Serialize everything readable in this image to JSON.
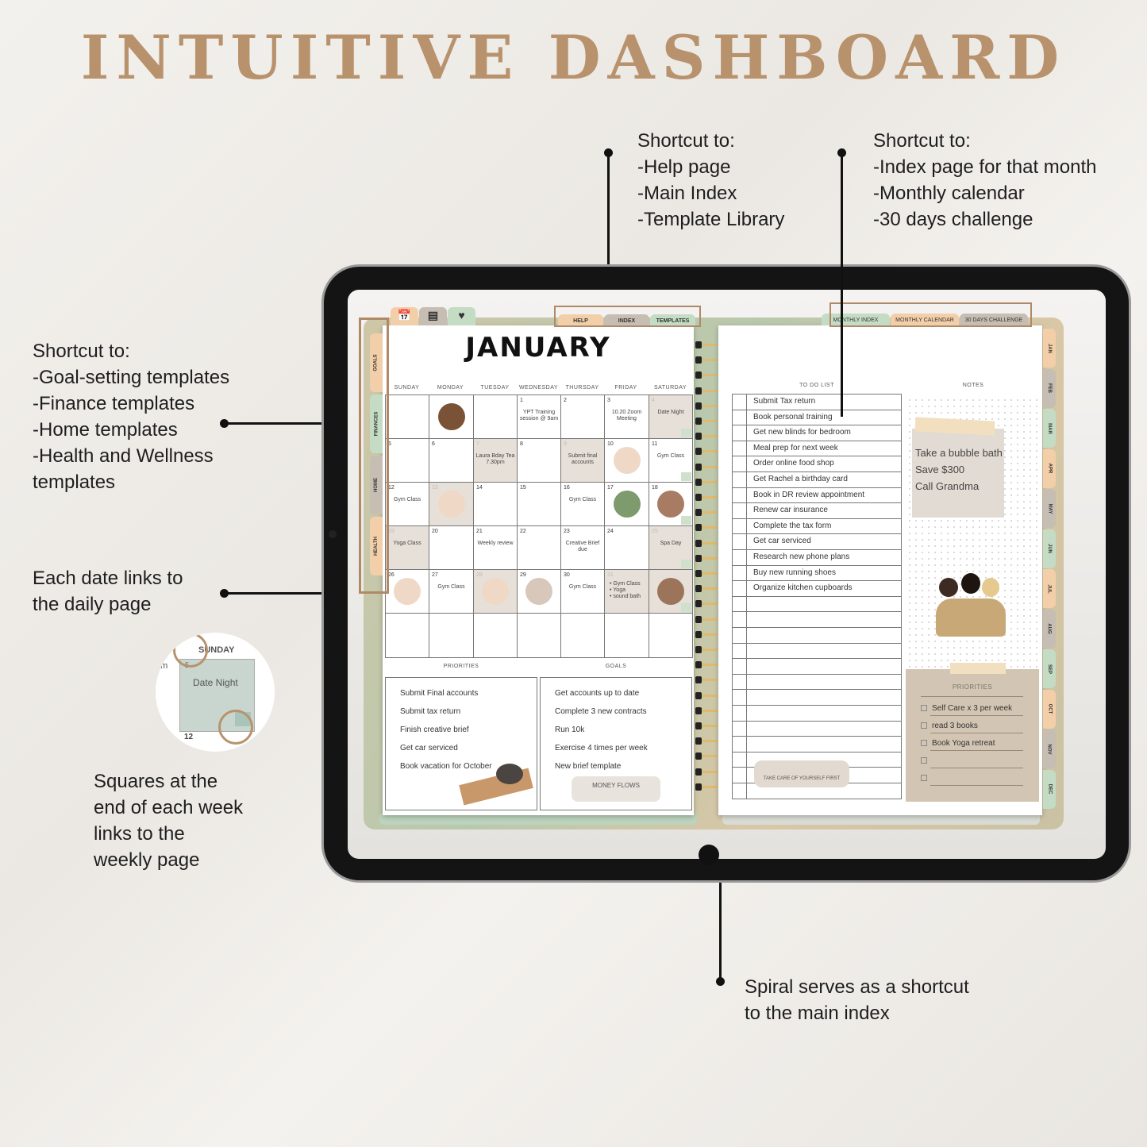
{
  "title": "INTUITIVE DASHBOARD",
  "annotations": {
    "top_middle": "Shortcut to:\n-Help page\n-Main Index\n-Template Library",
    "top_right": "Shortcut to:\n-Index page for that month\n-Monthly calendar\n-30 days challenge",
    "left_categories": "Shortcut to:\n-Goal-setting templates\n-Finance templates\n-Home templates\n-Health and Wellness\ntemplates",
    "left_dates": "Each date links to\nthe daily page",
    "left_weekly": "Squares at the\nend of each week\nlinks to the\nweekly page",
    "bottom_spiral": "Spiral serves as a shortcut\nto the main index"
  },
  "inset": {
    "day_header": "SUNDAY",
    "date": "5",
    "event": "Date Night",
    "next_date": "12",
    "side_text": "om"
  },
  "colors": {
    "accent": "#b8926c",
    "peach": "#f2cfa8",
    "gray": "#c6bdb3",
    "green": "#c4dcc4",
    "shaded": "#e7e0d8",
    "annotation_outline": "#b08a68"
  },
  "left_page": {
    "top_icons": [
      {
        "icon": "calendar-icon"
      },
      {
        "icon": "picture-frame-icon"
      },
      {
        "icon": "heart-icon"
      }
    ],
    "top_tabs": [
      "HELP",
      "INDEX",
      "TEMPLATES"
    ],
    "side_tabs": [
      "GOALS",
      "FINANCES",
      "HOME",
      "HEALTH"
    ],
    "month_title": "JANUARY",
    "weekdays": [
      "SUNDAY",
      "MONDAY",
      "TUESDAY",
      "WEDNESDAY",
      "THURSDAY",
      "FRIDAY",
      "SATURDAY"
    ],
    "cells": [
      {
        "day": "",
        "text": ""
      },
      {
        "day": "",
        "text": "",
        "image": "coffee-beans"
      },
      {
        "day": "",
        "text": ""
      },
      {
        "day": "1",
        "text": "YPT Training session @ 9am"
      },
      {
        "day": "2",
        "text": ""
      },
      {
        "day": "3",
        "text": "10.20 Zoom Meeting"
      },
      {
        "day": "4",
        "text": "Date Night",
        "shaded": true
      },
      {
        "day": "5",
        "text": ""
      },
      {
        "day": "6",
        "text": ""
      },
      {
        "day": "7",
        "text": "Laura Bday Tea 7.30pm",
        "shaded": true
      },
      {
        "day": "8",
        "text": ""
      },
      {
        "day": "9",
        "text": "Submit final accounts",
        "shaded": true
      },
      {
        "day": "10",
        "text": "",
        "image": "flower"
      },
      {
        "day": "11",
        "text": "Gym Class"
      },
      {
        "day": "12",
        "text": "Gym Class"
      },
      {
        "day": "13",
        "text": "",
        "shaded": true,
        "image": "flower"
      },
      {
        "day": "14",
        "text": ""
      },
      {
        "day": "15",
        "text": ""
      },
      {
        "day": "16",
        "text": "Gym Class"
      },
      {
        "day": "17",
        "text": "",
        "image": "plant"
      },
      {
        "day": "18",
        "text": "",
        "image": "iced-coffee"
      },
      {
        "day": "19",
        "text": "Yoga Class",
        "shaded": true
      },
      {
        "day": "20",
        "text": ""
      },
      {
        "day": "21",
        "text": "Weekly review"
      },
      {
        "day": "22",
        "text": ""
      },
      {
        "day": "23",
        "text": "Creative Brief due"
      },
      {
        "day": "24",
        "text": ""
      },
      {
        "day": "25",
        "text": "Spa Day",
        "shaded": true
      },
      {
        "day": "26",
        "text": "",
        "image": "flower"
      },
      {
        "day": "27",
        "text": "Gym Class"
      },
      {
        "day": "28",
        "text": "",
        "shaded": true,
        "image": "flower"
      },
      {
        "day": "29",
        "text": "",
        "image": "woman-robe"
      },
      {
        "day": "30",
        "text": "Gym Class"
      },
      {
        "day": "31",
        "text": "• Gym Class\n• Yoga\n• sound bath",
        "shaded": true
      },
      {
        "day": "",
        "text": "",
        "shaded": true,
        "image": "oil-bottle"
      }
    ],
    "priorities_title": "PRIORITIES",
    "priorities": [
      "Submit Final accounts",
      "Submit tax return",
      "Finish creative brief",
      "Get car serviced",
      "Book vacation for October"
    ],
    "goals_title": "GOALS",
    "goals": [
      "Get accounts up to date",
      "Complete 3 new contracts",
      "Run 10k",
      "Exercise 4 times per week",
      "New brief template"
    ],
    "goals_sticker": "MONEY FLOWS"
  },
  "right_page": {
    "top_tabs": [
      "MONTHLY INDEX",
      "MONTHLY CALENDAR",
      "30 DAYS CHALLENGE"
    ],
    "month_tabs": [
      "JAN",
      "FEB",
      "MAR",
      "APR",
      "MAY",
      "JUN",
      "JUL",
      "AUG",
      "SEP",
      "OCT",
      "NOV",
      "DEC"
    ],
    "todo_title": "TO DO LIST",
    "todos": [
      "Submit Tax return",
      "Book personal training",
      "Get new blinds for bedroom",
      "Meal prep for next week",
      "Order online food shop",
      "Get Rachel a birthday card",
      "Book in DR review appointment",
      "Renew car insurance",
      "Complete the tax form",
      "Get car serviced",
      "Research new phone plans",
      "Buy new running shoes",
      "Organize kitchen cupboards"
    ],
    "todo_sticker": "TAKE CARE OF YOURSELF FIRST",
    "notes_title": "NOTES",
    "notes": [
      "Take a bubble bath",
      "Save $300",
      "Call Grandma"
    ],
    "priorities_title": "PRIORITIES",
    "priorities": [
      "Self Care x 3 per week",
      "read 3 books",
      "Book Yoga retreat",
      "",
      ""
    ]
  }
}
